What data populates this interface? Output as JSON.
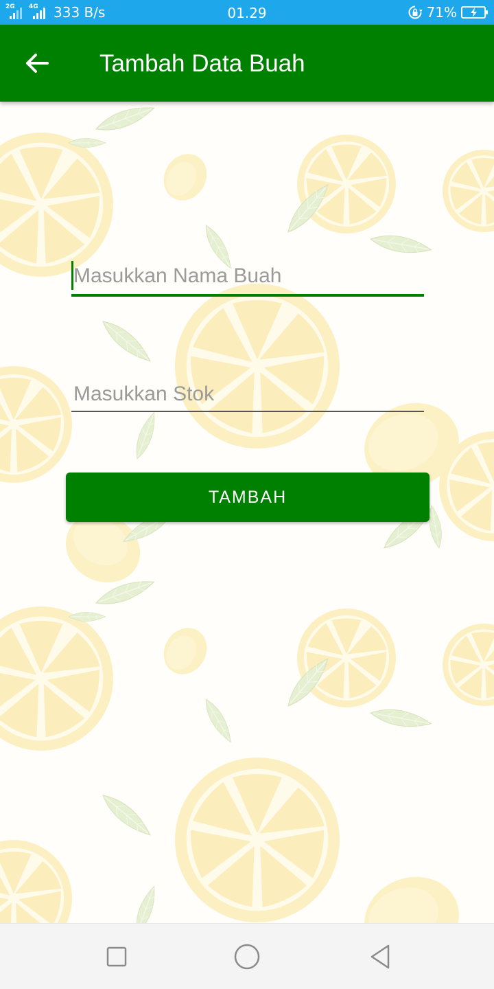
{
  "status_bar": {
    "signal1_label": "2G",
    "signal2_label": "4G",
    "network_speed": "333 B/s",
    "time": "01.29",
    "battery_percent": "71%",
    "battery_level": 71,
    "icons": [
      "signal-icon",
      "signal-icon",
      "rotation-lock-icon",
      "battery-charging-icon"
    ]
  },
  "app_bar": {
    "title": "Tambah Data Buah",
    "back_icon": "arrow-left-icon",
    "color": "#008000"
  },
  "form": {
    "nama_buah": {
      "value": "",
      "placeholder": "Masukkan Nama Buah",
      "focused": true
    },
    "stok": {
      "value": "",
      "placeholder": "Masukkan Stok",
      "focused": false
    },
    "submit_label": "TAMBAH"
  },
  "nav_bar": {
    "icons": [
      "recent-apps-icon",
      "home-icon",
      "back-icon"
    ]
  },
  "colors": {
    "status_bar": "#1ea7ea",
    "primary": "#008000",
    "placeholder": "#9a9a9a"
  }
}
